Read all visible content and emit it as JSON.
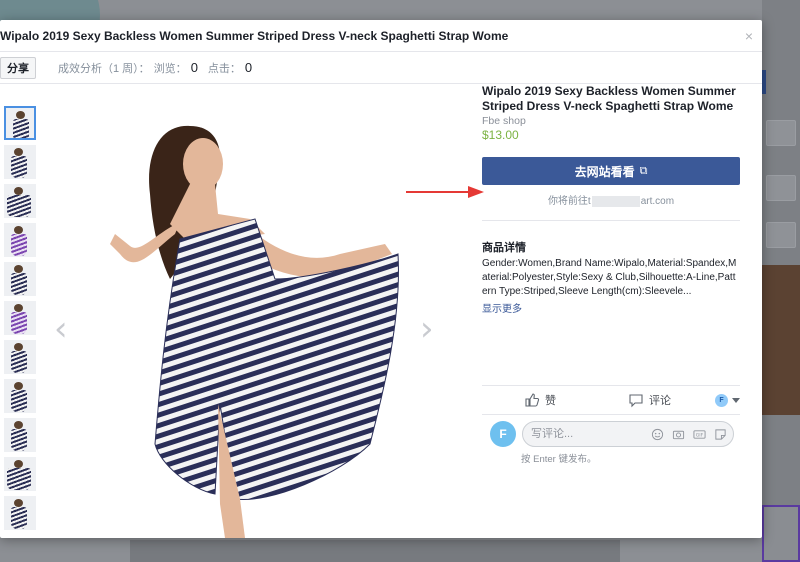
{
  "modal": {
    "title": "Wipalo 2019 Sexy Backless Women Summer Striped Dress V-neck Spaghetti Strap Wome",
    "close_icon": "×"
  },
  "toolbar": {
    "share_label": "分享",
    "analysis_label": "成效分析（1 周）：",
    "views_label": "浏览：",
    "views_value": "0",
    "clicks_label": "点击：",
    "clicks_value": "0"
  },
  "gallery": {
    "prev_icon": "‹",
    "next_icon": "›",
    "thumbnails": [
      "thumb-1",
      "thumb-2",
      "thumb-3",
      "thumb-4",
      "thumb-5",
      "thumb-6",
      "thumb-7",
      "thumb-8",
      "thumb-9",
      "thumb-10",
      "thumb-11"
    ]
  },
  "product": {
    "title": "Wipalo 2019 Sexy Backless Women Summer Striped Dress V-neck Spaghetti Strap Wome",
    "shop": "Fbe shop",
    "price": "$13.00",
    "visit_button": "去网站看看",
    "visit_note_prefix": "你将前往t",
    "visit_note_suffix": "art.com",
    "details_title": "商品详情",
    "details_text": "Gender:Women,Brand Name:Wipalo,Material:Spandex,Material:Polyester,Style:Sexy & Club,Silhouette:A-Line,Pattern Type:Striped,Sleeve Length(cm):Sleevele...",
    "show_more": "显示更多"
  },
  "actions": {
    "like_label": "赞",
    "comment_label": "评论",
    "avatar_letter": "F"
  },
  "comment": {
    "avatar_letter": "F",
    "placeholder": "写评论...",
    "hint": "按 Enter 键发布。"
  },
  "colors": {
    "accent": "#3b5998",
    "price": "#7cb342",
    "annotation_arrow": "#e53935"
  }
}
